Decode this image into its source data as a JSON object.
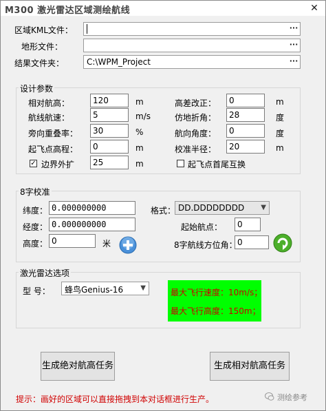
{
  "window": {
    "title": "M300 激光雷达区域测绘航线",
    "close_glyph": "✕"
  },
  "files": {
    "kml_label": "区域KML文件：",
    "kml_value": "",
    "terrain_label": "地形文件：",
    "terrain_value": "",
    "result_label": "结果文件夹：",
    "result_value": "C:\\WPM_Project",
    "browse_glyph": "···"
  },
  "design": {
    "group_title": "设计参数",
    "rel_height_label": "相对航高：",
    "rel_height_value": "120",
    "rel_height_unit": "m",
    "height_corr_label": "高差改正：",
    "height_corr_value": "0",
    "height_corr_unit": "m",
    "speed_label": "航线航速：",
    "speed_value": "5",
    "speed_unit": "m/s",
    "fold_angle_label": "仿地折角：",
    "fold_angle_value": "28",
    "fold_angle_unit": "度",
    "side_overlap_label": "旁向重叠率：",
    "side_overlap_value": "30",
    "side_overlap_unit": "%",
    "heading_label": "航向角度：",
    "heading_value": "0",
    "heading_unit": "度",
    "takeoff_alt_label": "起飞点高程：",
    "takeoff_alt_value": "0",
    "takeoff_alt_unit": "m",
    "calib_radius_label": "校准半径：",
    "calib_radius_value": "20",
    "calib_radius_unit": "m",
    "expand_label": "边界外扩",
    "expand_checked": true,
    "expand_value": "25",
    "expand_unit": "m",
    "swap_label": "起飞点首尾互换",
    "swap_checked": false
  },
  "calib8": {
    "group_title": "8字校准",
    "lat_label": "纬度：",
    "lat_value": "0.000000000",
    "lon_label": "经度：",
    "lon_value": "0.000000000",
    "alt_label": "高度：",
    "alt_value": "0",
    "alt_unit": "米",
    "format_label": "格式：",
    "format_value": "DD.DDDDDDDD",
    "start_point_label": "起始航点：",
    "start_point_value": "0",
    "azimuth_label": "8字航线方位角：",
    "azimuth_value": "0"
  },
  "lidar": {
    "group_title": "激光雷达选项",
    "model_label": "型 号：",
    "model_value": "蜂鸟Genius-16",
    "max_speed_text": "最大飞行速度：10m/s；",
    "max_height_text": "最大飞行高度：150m；"
  },
  "actions": {
    "abs_button": "生成绝对航高任务",
    "rel_button": "生成相对航高任务"
  },
  "hint": "提示：画好的区域可以直接拖拽到本对话框进行生产。",
  "watermark": "测绘参考",
  "colors": {
    "highlight": "#00ff00",
    "warning_text": "#cc0000",
    "hint_text": "#d00000"
  }
}
